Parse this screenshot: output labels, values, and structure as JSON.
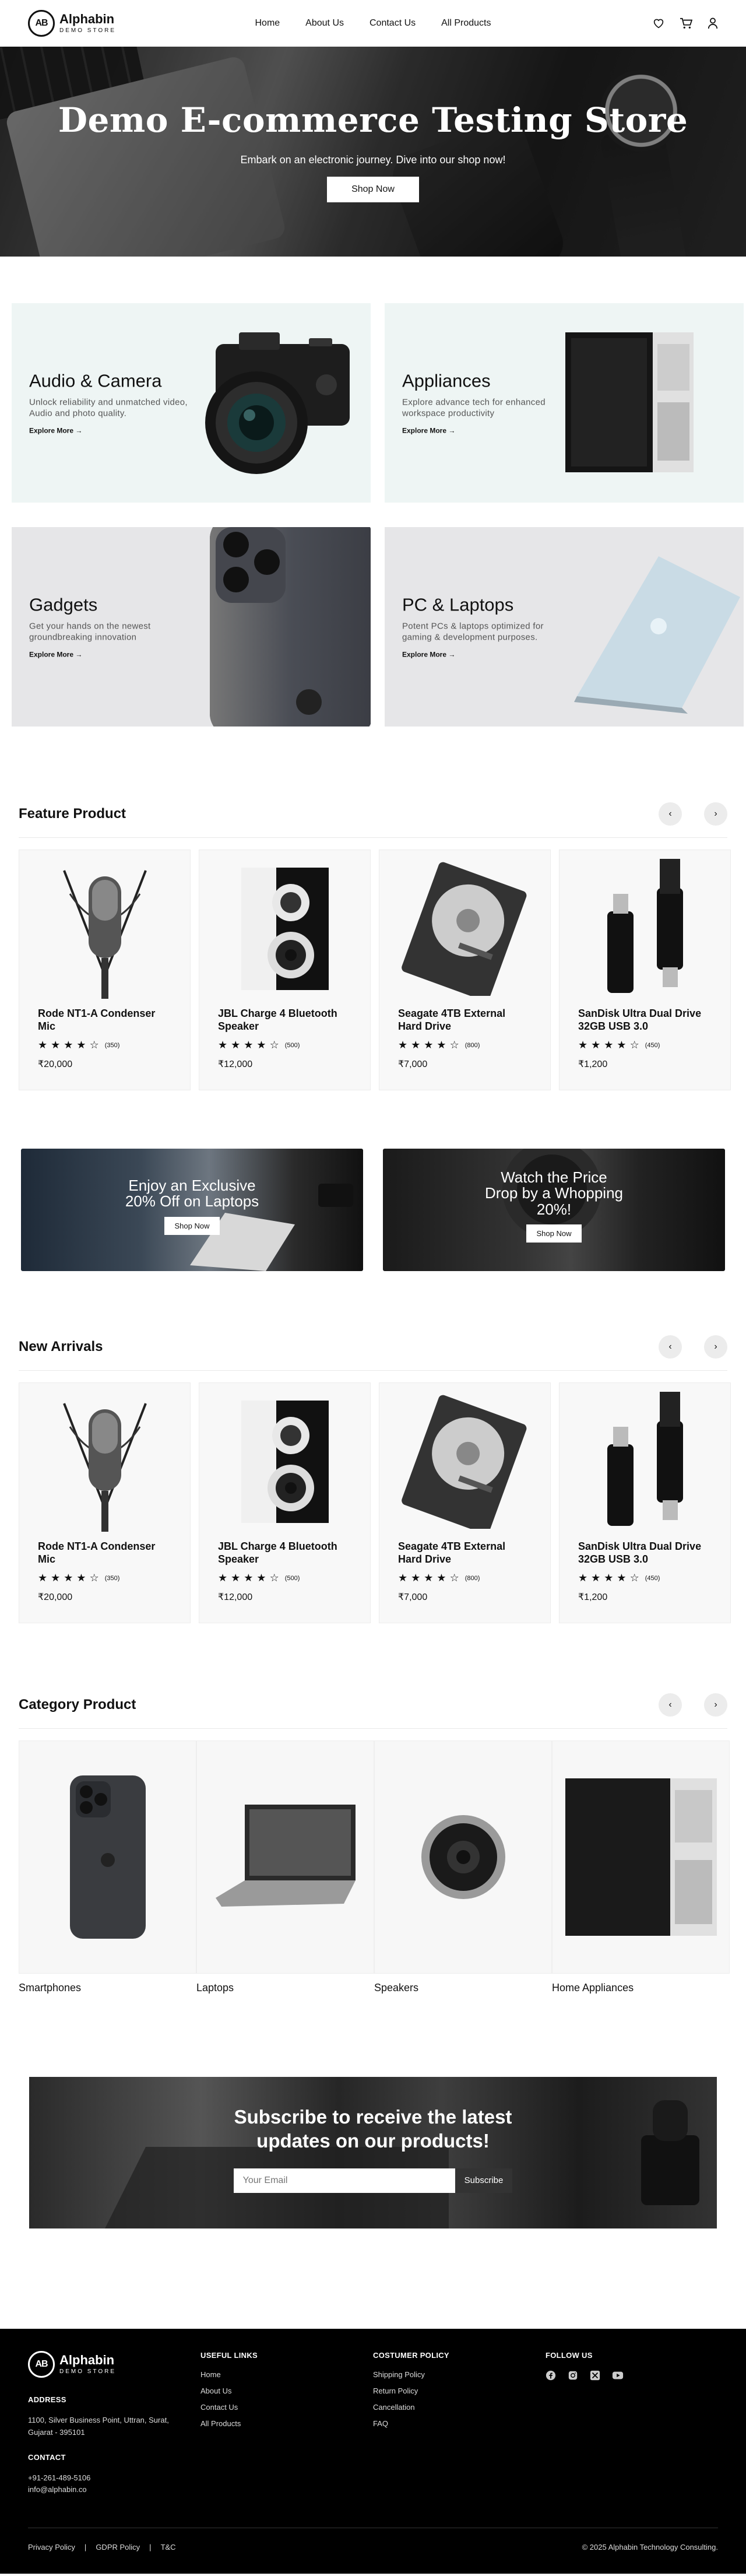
{
  "nav": {
    "logo_mark": "AB",
    "brand": "Alphabin",
    "brand_sub": "DEMO STORE",
    "links": [
      "Home",
      "About Us",
      "Contact Us",
      "All Products"
    ]
  },
  "hero": {
    "title": "Demo E-commerce Testing Store",
    "subtitle": "Embark on an electronic journey. Dive into our shop now!",
    "cta": "Shop Now"
  },
  "tiles": [
    {
      "title": "Audio & Camera",
      "desc": "Unlock reliability and unmatched video, Audio and photo quality.",
      "link": "Explore More"
    },
    {
      "title": "Appliances",
      "desc": "Explore advance tech for enhanced workspace productivity",
      "link": "Explore More"
    },
    {
      "title": "Gadgets",
      "desc": "Get your hands on the newest groundbreaking innovation",
      "link": "Explore More"
    },
    {
      "title": "PC & Laptops",
      "desc": "Potent PCs & laptops optimized for gaming & development purposes.",
      "link": "Explore More"
    }
  ],
  "featured": {
    "title": "Feature Product",
    "products": [
      {
        "name": "Rode NT1-A Condenser Mic",
        "rating": 4,
        "reviews": "(350)",
        "price": "₹20,000"
      },
      {
        "name": "JBL Charge 4 Bluetooth Speaker",
        "rating": 4,
        "reviews": "(500)",
        "price": "₹12,000"
      },
      {
        "name": "Seagate 4TB External Hard Drive",
        "rating": 4,
        "reviews": "(800)",
        "price": "₹7,000"
      },
      {
        "name": "SanDisk Ultra Dual Drive 32GB USB 3.0",
        "rating": 4,
        "reviews": "(450)",
        "price": "₹1,200"
      }
    ]
  },
  "promos": [
    {
      "line1": "Enjoy an Exclusive",
      "line2": "20% Off on Laptops",
      "line3": "",
      "cta": "Shop Now"
    },
    {
      "line1": "Watch the Price",
      "line2": "Drop by a Whopping",
      "line3": "20%!",
      "cta": "Shop Now"
    }
  ],
  "arrivals": {
    "title": "New Arrivals",
    "products": [
      {
        "name": "Rode NT1-A Condenser Mic",
        "rating": 4,
        "reviews": "(350)",
        "price": "₹20,000"
      },
      {
        "name": "JBL Charge 4 Bluetooth Speaker",
        "rating": 4,
        "reviews": "(500)",
        "price": "₹12,000"
      },
      {
        "name": "Seagate 4TB External Hard Drive",
        "rating": 4,
        "reviews": "(800)",
        "price": "₹7,000"
      },
      {
        "name": "SanDisk Ultra Dual Drive 32GB USB 3.0",
        "rating": 4,
        "reviews": "(450)",
        "price": "₹1,200"
      }
    ]
  },
  "categories": {
    "title": "Category Product",
    "items": [
      "Smartphones",
      "Laptops",
      "Speakers",
      "Home Appliances"
    ]
  },
  "subscribe": {
    "line1": "Subscribe to receive the latest",
    "line2": "updates on our products!",
    "placeholder": "Your Email",
    "button": "Subscribe"
  },
  "footer": {
    "brand": "Alphabin",
    "brand_sub": "DEMO STORE",
    "address_head": "ADDRESS",
    "address": "1100, Silver Business Point, Uttran, Surat, Gujarat - 395101",
    "contact_head": "CONTACT",
    "phone": "+91-261-489-5106",
    "email": "info@alphabin.co",
    "useful_head": "USEFUL LINKS",
    "useful": [
      "Home",
      "About Us",
      "Contact Us",
      "All Products"
    ],
    "policy_head": "COSTUMER POLICY",
    "policy": [
      "Shipping Policy",
      "Return Policy",
      "Cancellation",
      "FAQ"
    ],
    "follow_head": "FOLLOW US",
    "bottom_links": [
      "Privacy Policy",
      "GDPR Policy",
      "T&C"
    ],
    "separator": "|",
    "copyright": "© 2025 Alphabin Technology Consulting."
  },
  "icons": {
    "star_full": "★",
    "star_empty": "☆",
    "arrow_left": "‹",
    "arrow_right": "›",
    "link_arrow": "→"
  }
}
